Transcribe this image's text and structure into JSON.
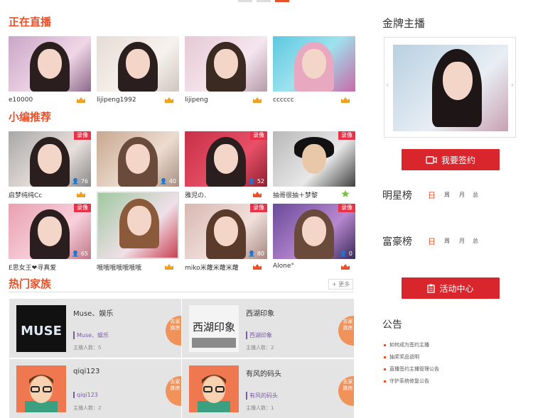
{
  "sections": {
    "live_title": "正在直播",
    "editor_title": "小编推荐",
    "family_title": "热门家族",
    "more_label": "更多"
  },
  "live": [
    {
      "name": "e10000"
    },
    {
      "name": "lijipeng1992"
    },
    {
      "name": "lijipeng"
    },
    {
      "name": "cccccc"
    }
  ],
  "recommend": [
    {
      "name": "启梦纯纯Cc",
      "viewers": "76",
      "rec": "录像"
    },
    {
      "name": "",
      "viewers": "40",
      "rec": ""
    },
    {
      "name": "雅児の．",
      "viewers": "52",
      "rec": "录像"
    },
    {
      "name": "抽哥很抽＋梦黎",
      "viewers": "",
      "rec": "录像"
    },
    {
      "name": "E思女王❤寻真爱",
      "viewers": "65",
      "rec": "录像"
    },
    {
      "name": "哦哦哦哦哦哦哦",
      "viewers": "",
      "rec": ""
    },
    {
      "name": "miko米蘿米蘿米蘿",
      "viewers": "80",
      "rec": "录像"
    },
    {
      "name": "Alone°",
      "viewers": "0",
      "rec": "录像"
    }
  ],
  "families": [
    {
      "name": "Muse、娱乐",
      "tag": "Muse、娱乐",
      "count": "主播人数：5",
      "goto": "去家族房"
    },
    {
      "name": "西湖印象",
      "tag": "西湖印象",
      "count": "主播人数：2",
      "goto": "去家族房"
    },
    {
      "name": "qiqi123",
      "tag": "qiqi123",
      "count": "主播人数：2",
      "goto": "去家族房"
    },
    {
      "name": "有风的码头",
      "tag": "有风的码头",
      "count": "主播人数：1",
      "goto": "去家族房"
    }
  ],
  "sidebar": {
    "gold_title": "金牌主播",
    "sign_button": "我要签约",
    "star_rank": "明星榜",
    "rich_rank": "富豪榜",
    "tabs": [
      "日",
      "周",
      "月",
      "总"
    ],
    "activity_button": "活动中心",
    "notice_title": "公告",
    "notices": [
      "如何成为签约主播",
      "抽奖奖品说明",
      "直播签约主播管理公告",
      "守护系统修复公告"
    ]
  },
  "logo_text": {
    "muse": "MUSE",
    "xihu": "西湖印象"
  },
  "colors": {
    "accent": "#e8512a",
    "red_button": "#d8262c",
    "tag_purple": "#7b5aa6",
    "gold": "#f0a020"
  }
}
